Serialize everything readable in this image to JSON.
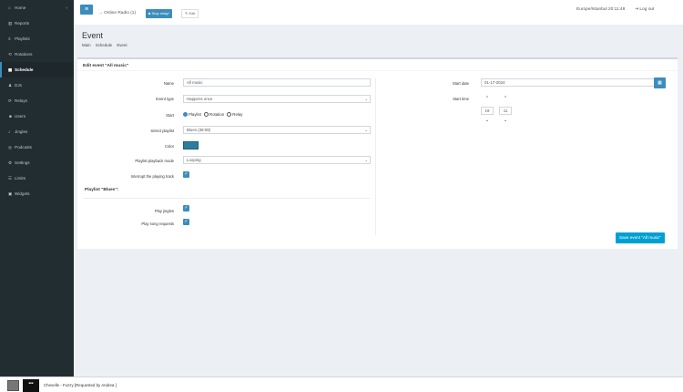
{
  "sidebar": {
    "items": [
      {
        "icon": "home-icon",
        "glyph": "⌂",
        "label": "Home",
        "chevron": "‹"
      },
      {
        "icon": "reports-icon",
        "glyph": "▥",
        "label": "Reports"
      },
      {
        "icon": "playlists-icon",
        "glyph": "≡",
        "label": "Playlists"
      },
      {
        "icon": "rotations-icon",
        "glyph": "⟲",
        "label": "Rotations"
      },
      {
        "icon": "schedule-icon",
        "glyph": "▦",
        "label": "Schedule"
      },
      {
        "icon": "djs-icon",
        "glyph": "♟",
        "label": "DJs"
      },
      {
        "icon": "relays-icon",
        "glyph": "⟳",
        "label": "Relays"
      },
      {
        "icon": "users-icon",
        "glyph": "☻",
        "label": "Users"
      },
      {
        "icon": "jingles-icon",
        "glyph": "♪",
        "label": "Jingles"
      },
      {
        "icon": "podcasts-icon",
        "glyph": "◎",
        "label": "Podcasts"
      },
      {
        "icon": "settings-icon",
        "glyph": "⚙",
        "label": "Settings"
      },
      {
        "icon": "limits-icon",
        "glyph": "☰",
        "label": "Limits"
      },
      {
        "icon": "widgets-icon",
        "glyph": "▣",
        "label": "Widgets"
      }
    ]
  },
  "header": {
    "menu_glyph": "≡",
    "radio_label": "Online Radio (1)",
    "live_label": "Stop relay!",
    "edit_label": "Edit",
    "timezone": "Europe/Istanbul 20:11:48",
    "logout_label": "Log out"
  },
  "page": {
    "title": "Event",
    "breadcrumb": [
      "Main",
      "Schedule",
      "Event"
    ]
  },
  "form": {
    "box_title": "Edit event \"All music\"",
    "name_label": "Name",
    "name_value": "All music",
    "event_type_label": "Event type",
    "event_type_value": "Happens once",
    "start_label": "Start",
    "start_options": [
      "Playlist",
      "Rotation",
      "Relay"
    ],
    "select_playlist_label": "Select playlist",
    "select_playlist_value": "Blues (38:08)",
    "color_label": "Color",
    "playback_mode_label": "Playlist playback mode",
    "playback_mode_value": "Looping",
    "interrupt_label": "Interrupt the playing track",
    "playlist_section": "Playlist \"Blues\":",
    "play_jingles_label": "Play jingles",
    "play_requests_label": "Play song requests",
    "start_date_label": "Start date",
    "start_date_value": "01-17-2024",
    "start_time_label": "Start time",
    "hour": "19",
    "minute": "11",
    "save_label": "Save event \"All music\""
  },
  "footer": {
    "thumb_text": "■■■",
    "now_playing": "Chevelle - Fuzzy [Requested by Andrea ]"
  },
  "colors": {
    "sidebar_bg": "#222d32",
    "accent": "#3c8dbc",
    "save_button": "#00a0d2",
    "event_color": "#2e7d9f"
  }
}
